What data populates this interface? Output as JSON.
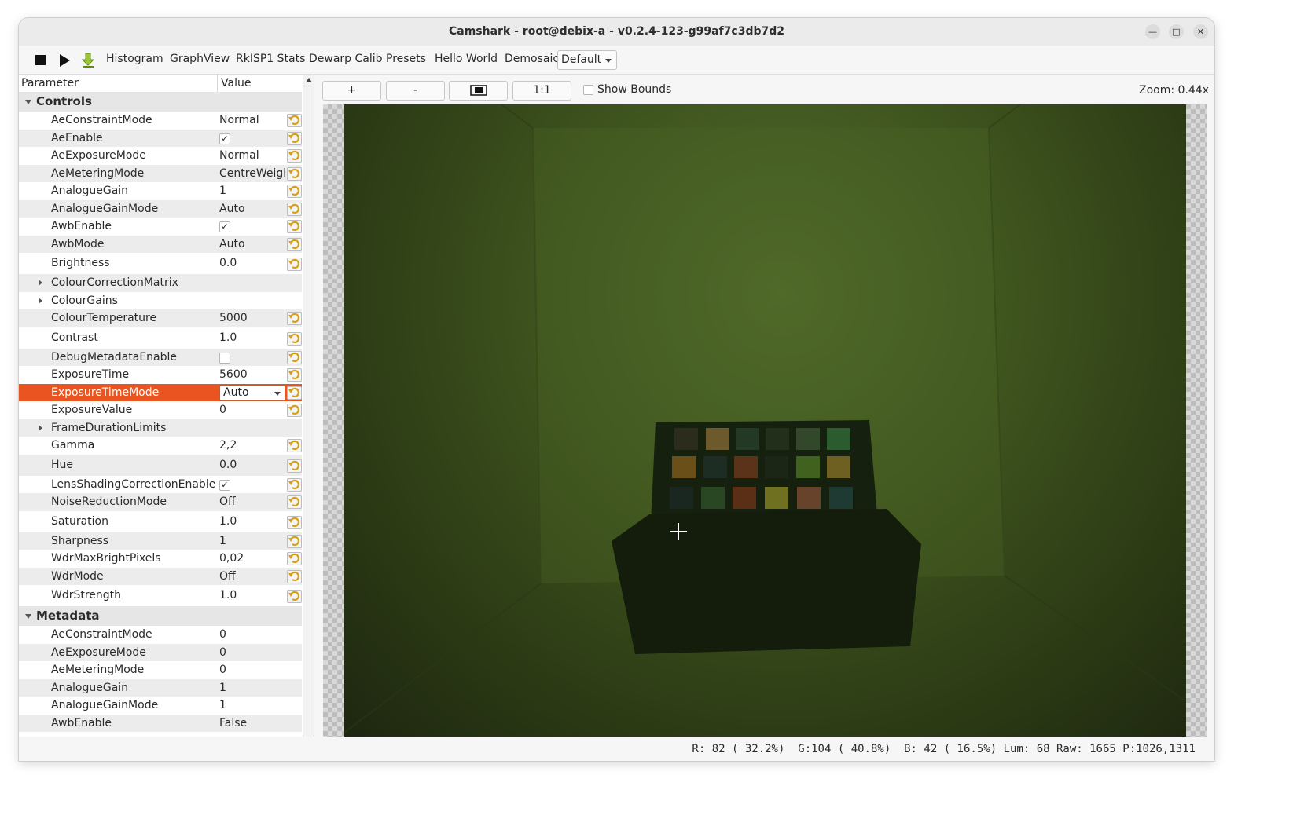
{
  "window": {
    "title": "Camshark - root@debix-a - v0.2.4-123-g99af7c3db7d2"
  },
  "toolbar": {
    "items": [
      "Histogram",
      "GraphView",
      "RkISP1 Stats",
      "Dewarp Calib",
      "Presets",
      "Hello World"
    ],
    "demosaic_label": "Demosaic:",
    "demosaic_value": "Default"
  },
  "tree": {
    "header_parameter": "Parameter",
    "header_value": "Value",
    "controls_title": "Controls",
    "controls": [
      {
        "name": "AeConstraintMode",
        "value": "Normal",
        "kind": "text",
        "reset": true
      },
      {
        "name": "AeEnable",
        "value": "",
        "kind": "check",
        "checked": true,
        "reset": true
      },
      {
        "name": "AeExposureMode",
        "value": "Normal",
        "kind": "text",
        "reset": true
      },
      {
        "name": "AeMeteringMode",
        "value": "CentreWeigh",
        "kind": "text",
        "reset": true
      },
      {
        "name": "AnalogueGain",
        "value": "1",
        "kind": "text",
        "reset": true
      },
      {
        "name": "AnalogueGainMode",
        "value": "Auto",
        "kind": "text",
        "reset": true
      },
      {
        "name": "AwbEnable",
        "value": "",
        "kind": "check",
        "checked": true,
        "reset": true
      },
      {
        "name": "AwbMode",
        "value": "Auto",
        "kind": "text",
        "reset": true
      },
      {
        "name": "Brightness",
        "value": "0.0",
        "kind": "text",
        "reset": true,
        "tall": true
      },
      {
        "name": "ColourCorrectionMatrix",
        "value": "",
        "kind": "expand",
        "reset": false
      },
      {
        "name": "ColourGains",
        "value": "",
        "kind": "expand",
        "reset": false
      },
      {
        "name": "ColourTemperature",
        "value": "5000",
        "kind": "text",
        "reset": true
      },
      {
        "name": "Contrast",
        "value": "1.0",
        "kind": "text",
        "reset": true,
        "tall": true
      },
      {
        "name": "DebugMetadataEnable",
        "value": "",
        "kind": "check",
        "checked": false,
        "reset": true
      },
      {
        "name": "ExposureTime",
        "value": "5600",
        "kind": "text",
        "reset": true
      },
      {
        "name": "ExposureTimeMode",
        "value": "Auto",
        "kind": "combo",
        "reset": true,
        "selected": true
      },
      {
        "name": "ExposureValue",
        "value": "0",
        "kind": "text",
        "reset": true
      },
      {
        "name": "FrameDurationLimits",
        "value": "",
        "kind": "expand",
        "reset": false
      },
      {
        "name": "Gamma",
        "value": "2,2",
        "kind": "text",
        "reset": true
      },
      {
        "name": "Hue",
        "value": "0.0",
        "kind": "text",
        "reset": true,
        "tall": true
      },
      {
        "name": "LensShadingCorrectionEnable",
        "value": "",
        "kind": "check",
        "checked": true,
        "reset": true
      },
      {
        "name": "NoiseReductionMode",
        "value": "Off",
        "kind": "text",
        "reset": true
      },
      {
        "name": "Saturation",
        "value": "1.0",
        "kind": "text",
        "reset": true,
        "tall": true
      },
      {
        "name": "Sharpness",
        "value": "1",
        "kind": "text",
        "reset": true
      },
      {
        "name": "WdrMaxBrightPixels",
        "value": "0,02",
        "kind": "text",
        "reset": true
      },
      {
        "name": "WdrMode",
        "value": "Off",
        "kind": "text",
        "reset": true
      },
      {
        "name": "WdrStrength",
        "value": "1.0",
        "kind": "text",
        "reset": true,
        "tall": true
      }
    ],
    "metadata_title": "Metadata",
    "metadata": [
      {
        "name": "AeConstraintMode",
        "value": "0"
      },
      {
        "name": "AeExposureMode",
        "value": "0"
      },
      {
        "name": "AeMeteringMode",
        "value": "0"
      },
      {
        "name": "AnalogueGain",
        "value": "1"
      },
      {
        "name": "AnalogueGainMode",
        "value": "1"
      },
      {
        "name": "AwbEnable",
        "value": "False"
      }
    ]
  },
  "viewer": {
    "zoom_in": "+",
    "zoom_out": "-",
    "fit_icon": "fit-window-icon",
    "one_to_one": "1:1",
    "show_bounds": "Show Bounds",
    "zoom_label": "Zoom: 0.44x"
  },
  "status": {
    "readout": "R: 82 ( 32.2%)  G:104 ( 40.8%)  B: 42 ( 16.5%) Lum: 68 Raw: 1665 P:1026,1311"
  },
  "colors": {
    "selection": "#e95420",
    "reset_icon": "#d4a017"
  }
}
